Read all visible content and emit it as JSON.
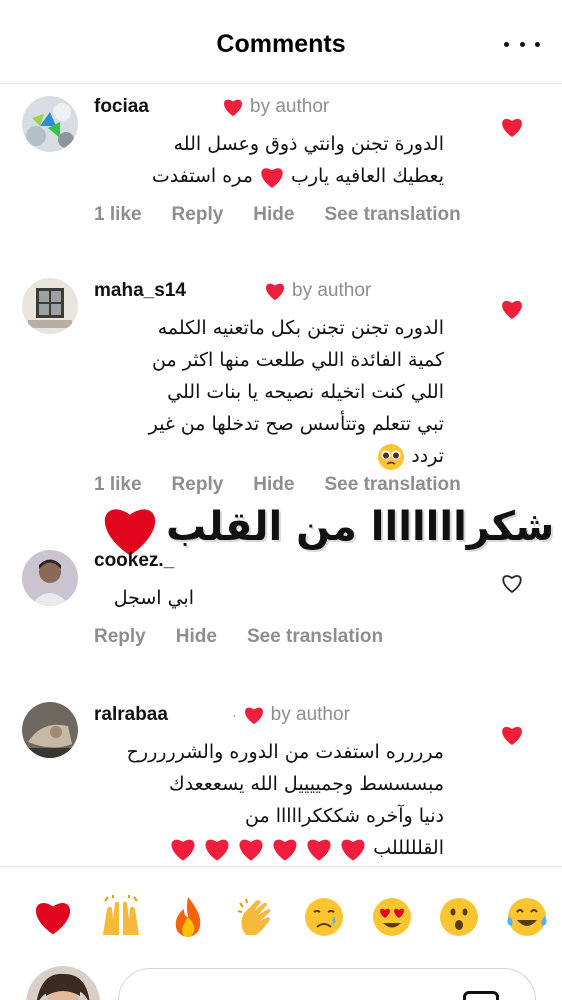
{
  "header": {
    "title": "Comments"
  },
  "comments": [
    {
      "username": "fociaa",
      "author_label": "by author",
      "lines": [
        "الدورة تجنن وانتي ذوق وعسل الله",
        "يعطيك العافيه يارب",
        "مره استفدت"
      ],
      "actions": [
        "1 like",
        "Reply",
        "Hide",
        "See translation"
      ]
    },
    {
      "username": "maha_s14",
      "author_label": "by author",
      "lines": [
        "الدوره تجنن تجنن بكل ماتعنيه الكلمه",
        "كمية الفائدة اللي طلعت منها اكثر من",
        "اللي كنت اتخيله نصيحه يا بنات اللي",
        "تبي تتعلم وتتأسس صح تدخلها من غير",
        "تردد"
      ],
      "actions": [
        "1 like",
        "Reply",
        "Hide",
        "See translation"
      ]
    },
    {
      "username": "cookez._",
      "lines": [
        "ابي اسجل"
      ],
      "actions": [
        "Reply",
        "Hide",
        "See translation"
      ]
    },
    {
      "username": "ralrabaa",
      "author_label": "by author",
      "author_dot": "·",
      "lines": [
        "مرررره استفدت من الدوره والشرررررح",
        "مبسسسط وجمييييل الله يسعععدك",
        "دنيا وآخره شكككرااااا من",
        "القلللللب"
      ]
    }
  ],
  "overlay": {
    "text": "شكرااااااا من القلب"
  },
  "emoji_bar": [
    "red-heart",
    "raised-hands",
    "fire",
    "clapping-hands",
    "crying-face",
    "heart-eyes-face",
    "surprised-face",
    "tears-of-joy-face"
  ],
  "colors": {
    "accent_red": "#ed1f3c",
    "muted": "#8e8e8e",
    "border": "#e6e6e6"
  }
}
